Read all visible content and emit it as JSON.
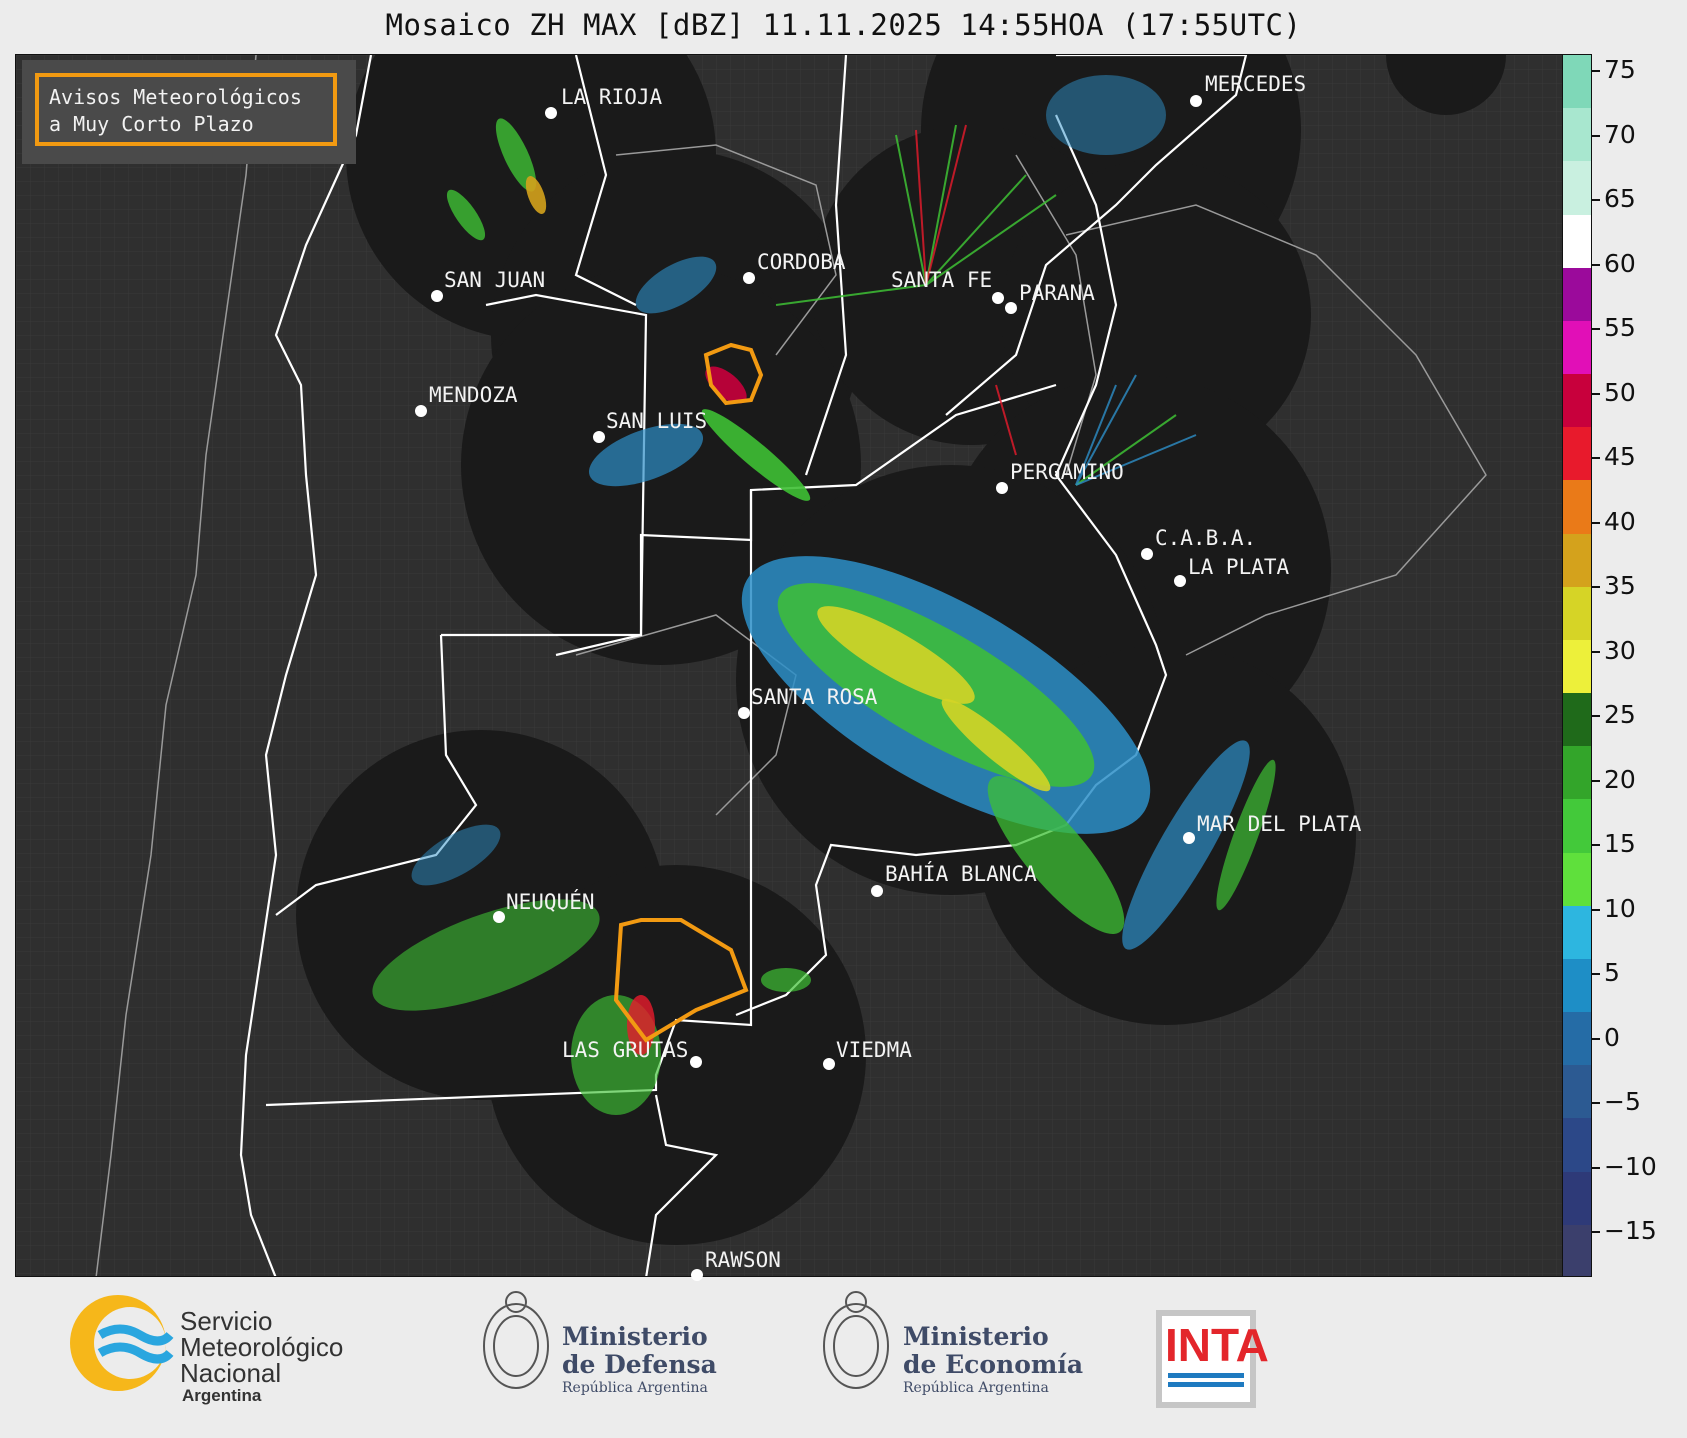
{
  "title": "Mosaico ZH MAX [dBZ] 11.11.2025 14:55HOA (17:55UTC)",
  "avisos": {
    "line1": "Avisos Meteorológicos",
    "line2": "a Muy Corto Plazo"
  },
  "cities": [
    {
      "name": "LA RIOJA"
    },
    {
      "name": "MERCEDES"
    },
    {
      "name": "SAN JUAN"
    },
    {
      "name": "CORDOBA"
    },
    {
      "name": "SANTA FE"
    },
    {
      "name": "PARANA"
    },
    {
      "name": "MENDOZA"
    },
    {
      "name": "SAN LUIS"
    },
    {
      "name": "PERGAMINO"
    },
    {
      "name": "C.A.B.A."
    },
    {
      "name": "LA PLATA"
    },
    {
      "name": "SANTA ROSA"
    },
    {
      "name": "MAR DEL PLATA"
    },
    {
      "name": "BAHÍA BLANCA"
    },
    {
      "name": "NEUQUÉN"
    },
    {
      "name": "LAS GRUTAS"
    },
    {
      "name": "VIEDMA"
    },
    {
      "name": "RAWSON"
    }
  ],
  "colorbar": {
    "ticks": [
      "75",
      "70",
      "65",
      "60",
      "55",
      "50",
      "45",
      "40",
      "35",
      "30",
      "25",
      "20",
      "15",
      "10",
      "5",
      "0",
      "−5",
      "−10",
      "−15"
    ],
    "colors": [
      "#7fd8b8",
      "#a8e7cf",
      "#c9f0e0",
      "#ffffff",
      "#9b0a9b",
      "#e10fb7",
      "#c8003c",
      "#e81a2c",
      "#ea7a18",
      "#d4a21c",
      "#d6d426",
      "#edf03a",
      "#1f6a1a",
      "#33a52a",
      "#43c93a",
      "#5fe03c",
      "#2db6e0",
      "#1e8ec6",
      "#256ca6",
      "#2c5a92",
      "#2c4888",
      "#2e3a78",
      "#3b3f6c"
    ]
  },
  "logos": {
    "smn": {
      "line1": "Servicio",
      "line2": "Meteorológico",
      "line3": "Nacional",
      "line4": "Argentina"
    },
    "defensa": {
      "line1": "Ministerio",
      "line2": "de Defensa",
      "line3": "República Argentina"
    },
    "economia": {
      "line1": "Ministerio",
      "line2": "de Economía",
      "line3": "República Argentina"
    },
    "inta": {
      "text": "INTA"
    }
  }
}
